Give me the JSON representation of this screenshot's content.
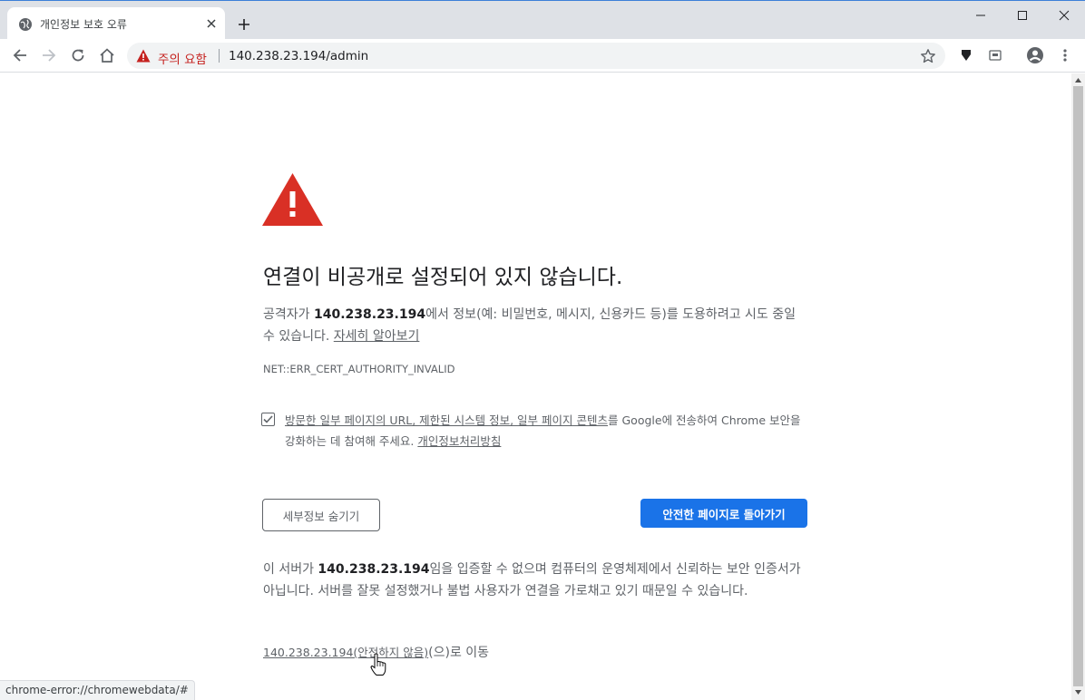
{
  "tab": {
    "title": "개인정보 보호 오류"
  },
  "toolbar": {
    "security_label": "주의 요함",
    "url": "140.238.23.194/admin"
  },
  "interstitial": {
    "heading": "연결이 비공개로 설정되어 있지 않습니다.",
    "para1_prefix": "공격자가 ",
    "host": "140.238.23.194",
    "para1_suffix": "에서 정보(예: 비밀번호, 메시지, 신용카드 등)를 도용하려고 시도 중일 수 있습니다. ",
    "learn_more": "자세히 알아보기",
    "error_code": "NET::ERR_CERT_AUTHORITY_INVALID",
    "optin_link1": "방문한 일부 페이지의 URL, 제한된 시스템 정보, 일부 페이지 콘텐츠",
    "optin_text1": "를 Google에 전송하여 Chrome 보안을 강화하는 데 참여해 주세요. ",
    "optin_link2": "개인정보처리방침",
    "details_button": "세부정보 숨기기",
    "back_button": "안전한 페이지로 돌아가기",
    "para2_prefix": "이 서버가 ",
    "para2_suffix": "임을 입증할 수 없으며 컴퓨터의 운영체제에서 신뢰하는 보안 인증서가 아닙니다. 서버를 잘못 설정했거나 불법 사용자가 연결을 가로채고 있기 때문일 수 있습니다.",
    "proceed_link": "140.238.23.194(안전하지 않음)",
    "proceed_suffix": "(으)로 이동"
  },
  "statusbar": {
    "text": "chrome-error://chromewebdata/#"
  },
  "colors": {
    "warning_red": "#d93025",
    "accent_blue": "#1a73e8"
  }
}
